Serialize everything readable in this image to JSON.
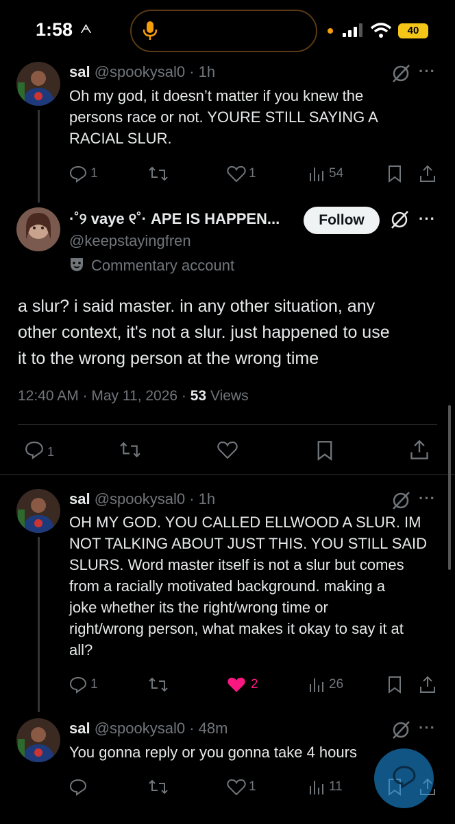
{
  "status_bar": {
    "time": "1:58",
    "signal_tag": "ᗅ",
    "battery": "40"
  },
  "tweets": [
    {
      "name": "sal",
      "handle": "@spookysal0 · 1h",
      "text": [
        "Oh my god, it doesn’t matter if you knew the",
        "persons race or not. YOURE STILL SAYING A",
        "RACIAL SLUR."
      ],
      "replies": "1",
      "likes": "1",
      "views": "54"
    },
    {
      "name": "·˚୨ vaye ୧˚· APE IS HAPPEN...",
      "handle": "@keepstayingfren",
      "label": "Commentary account",
      "follow_label": "Follow",
      "text": [
        "a slur? i said master. in any other situation, any",
        "other context, it's not a slur. just happened to use",
        "it to the wrong person at the wrong time"
      ],
      "timestamp": "12:40 AM · May 11, 2026 · ",
      "views_count": "53",
      "views_label": " Views",
      "replies": "1"
    },
    {
      "name": "sal",
      "handle": "@spookysal0 · 1h",
      "text": [
        "OH MY GOD. YOU CALLED ELLWOOD A SLUR. IM",
        "NOT TALKING ABOUT JUST THIS. YOU STILL SAID",
        "SLURS. Word master itself is not a slur but comes",
        "from a racially motivated background. making a",
        "joke whether its the right/wrong time or",
        "right/wrong person, what makes it okay to say it at",
        "all?"
      ],
      "replies": "1",
      "likes": "2",
      "views": "26"
    },
    {
      "name": "sal",
      "handle": "@spookysal0 · 48m",
      "text": [
        "You gonna reply or you gonna take 4 hours"
      ],
      "likes": "1",
      "views": "11"
    }
  ],
  "colors": {
    "background": "#000000",
    "text": "#e7e9ea",
    "muted": "#71767b",
    "like_active": "#f91880",
    "accent": "#1d9bf0"
  },
  "icons": [
    "mic-icon",
    "grok-icon",
    "more-icon",
    "reply-icon",
    "retweet-icon",
    "like-icon",
    "views-icon",
    "bookmark-icon",
    "share-icon",
    "compose-icon",
    "commentary-label-icon"
  ]
}
